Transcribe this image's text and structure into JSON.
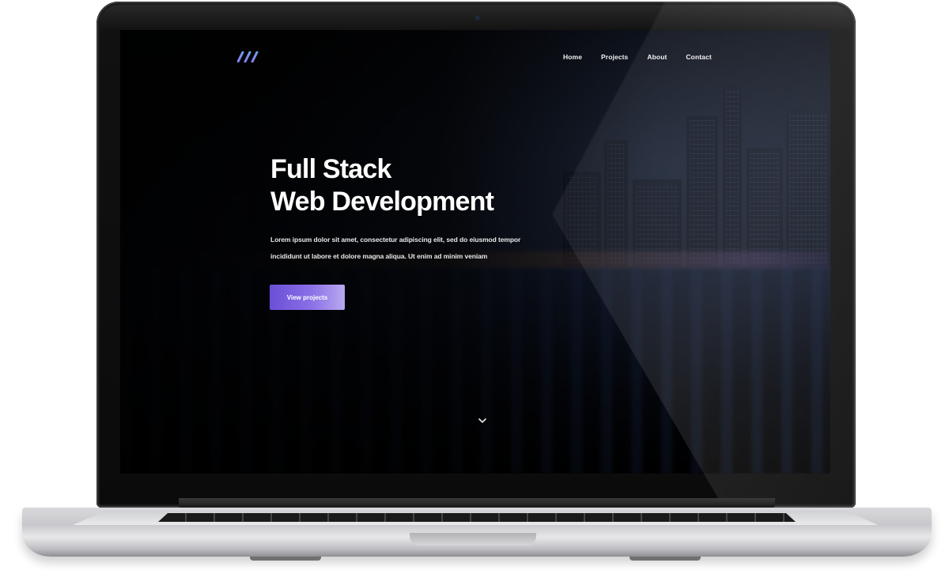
{
  "site": {
    "nav": {
      "items": [
        {
          "label": "Home"
        },
        {
          "label": "Projects"
        },
        {
          "label": "About"
        },
        {
          "label": "Contact"
        }
      ]
    },
    "hero": {
      "title_line1": "Full Stack",
      "title_line2": "Web Development",
      "body_line1": "Lorem ipsum dolor sit amet, consectetur adipiscing elit, sed do eiusmod tempor",
      "body_line2": "incididunt ut labore et dolore magna aliqua. Ut enim ad minim veniam",
      "cta_label": "View projects"
    },
    "icons": {
      "logo": "logo-mark-icon",
      "scroll": "chevron-down-icon"
    },
    "colors": {
      "accent": "#7b5fe0",
      "accent_light": "#b9a9f0",
      "logo": "#7a86f0",
      "text": "#ffffff"
    }
  }
}
